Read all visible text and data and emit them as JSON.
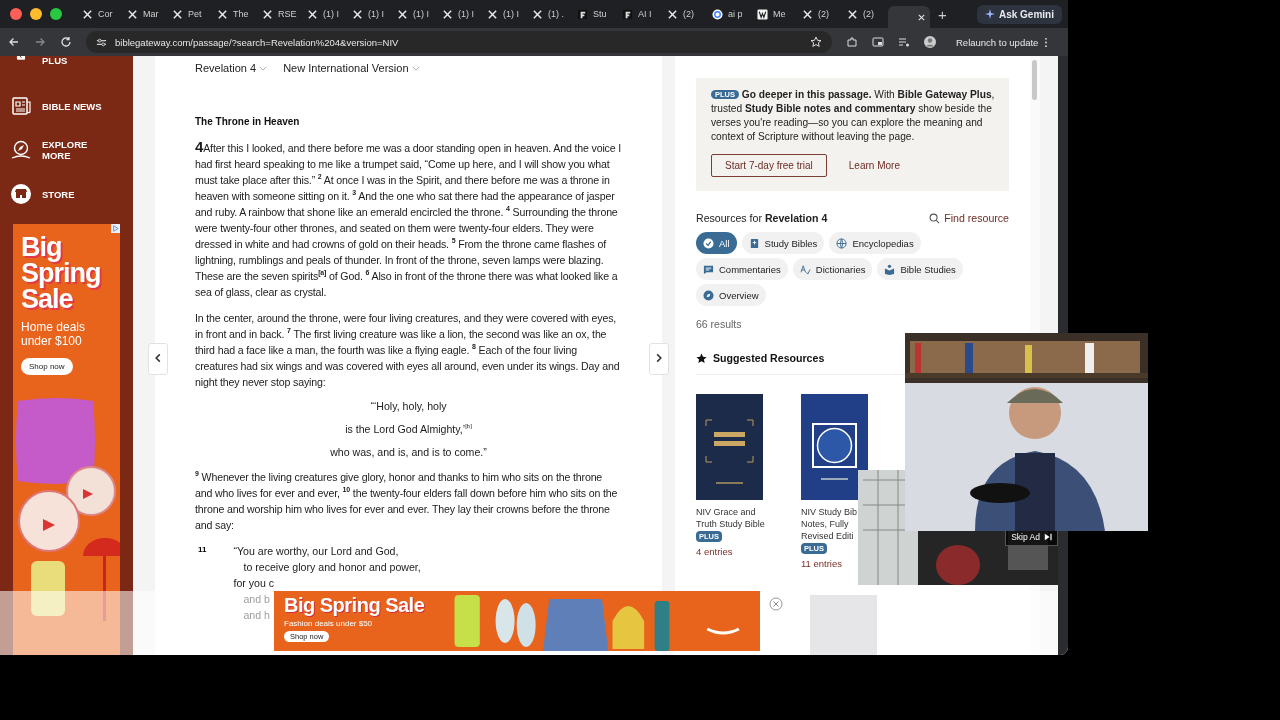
{
  "browser": {
    "tabs": [
      {
        "title": "Cor",
        "kind": "x",
        "selected": false
      },
      {
        "title": "Mar",
        "kind": "x",
        "selected": false
      },
      {
        "title": "Pet",
        "kind": "x",
        "selected": false
      },
      {
        "title": "The",
        "kind": "x",
        "selected": false
      },
      {
        "title": "RSE",
        "kind": "x",
        "selected": false
      },
      {
        "title": "(1) I",
        "kind": "x",
        "selected": false
      },
      {
        "title": "(1) I",
        "kind": "x",
        "selected": false
      },
      {
        "title": "(1) I",
        "kind": "x",
        "selected": false
      },
      {
        "title": "(1) I",
        "kind": "x",
        "selected": false
      },
      {
        "title": "(1) I",
        "kind": "x",
        "selected": false
      },
      {
        "title": "(1) .",
        "kind": "x",
        "selected": false
      },
      {
        "title": "Stu",
        "kind": "dark",
        "selected": false
      },
      {
        "title": "AI I",
        "kind": "dark",
        "selected": false
      },
      {
        "title": "(2)",
        "kind": "x",
        "selected": false
      },
      {
        "title": "ai p",
        "kind": "google",
        "selected": false
      },
      {
        "title": "Me",
        "kind": "light",
        "selected": false
      },
      {
        "title": "(2)",
        "kind": "x",
        "selected": false
      },
      {
        "title": "(2)",
        "kind": "x",
        "selected": false
      },
      {
        "kind": "blank",
        "selected": true
      }
    ],
    "new_tab": "+",
    "ask_button": "Ask Gemini",
    "url": "biblegateway.com/passage/?search=Revelation%204&version=NIV",
    "relaunch_button": "Relaunch to update"
  },
  "sidebar": {
    "items": [
      {
        "label": "PLUS",
        "kind": "plus"
      },
      {
        "label": "BIBLE NEWS",
        "kind": "news"
      },
      {
        "label": "EXPLORE MORE",
        "kind": "compass"
      },
      {
        "label": "STORE",
        "kind": "store"
      }
    ]
  },
  "side_ad": {
    "headline": "Big Spring Sale",
    "subline": "Home deals under $100",
    "button": "Shop now"
  },
  "passage": {
    "reference": "Revelation 4",
    "version": "New International Version",
    "heading": "The Throne in Heaven",
    "blocks": [
      {
        "kind": "prose",
        "chapter": "4",
        "text": "After this I looked, and there before me was a door standing open in heaven. And the voice I had first heard speaking to me like a trumpet said, “Come up here, and I will show you what must take place after this.” $^{2}$ At once I was in the Spirit, and there before me was a throne in heaven with someone sitting on it. $^{3}$ And the one who sat there had the appearance of jasper and ruby. A rainbow that shone like an emerald encircled the throne. $^{4}$ Surrounding the throne were twenty-four other thrones, and seated on them were twenty-four elders. They were dressed in white and had crowns of gold on their heads. $^{5}$ From the throne came flashes of lightning, rumblings and peals of thunder. In front of the throne, seven lamps were blazing. These are the seven spirits$^{[a]}$ of God. $^{6}$ Also in front of the throne there was what looked like a sea of glass, clear as crystal."
      },
      {
        "kind": "prose",
        "text": "In the center, around the throne, were four living creatures, and they were covered with eyes, in front and in back. $^{7}$ The first living creature was like a lion, the second was like an ox, the third had a face like a man, the fourth was like a flying eagle. $^{8}$ Each of the four living creatures had six wings and was covered with eyes all around, even under its wings. Day and night they never stop saying:"
      },
      {
        "kind": "centered",
        "lines": [
          {
            "text": "“‘Holy, holy, holy"
          },
          {
            "text": "is the Lord God Almighty,’$^{[b]}$"
          },
          {
            "text": "who was, and is, and is to come.”"
          }
        ]
      },
      {
        "kind": "prose",
        "text": "$^{9}$ Whenever the living creatures give glory, honor and thanks to him who sits on the throne and who lives for ever and ever, $^{10}$ the twenty-four elders fall down before him who sits on the throne and worship him who lives for ever and ever. They lay their crowns before the throne and say:"
      },
      {
        "kind": "poem",
        "verse": "11",
        "lines": [
          {
            "text": "“You are worthy, our Lord and God,",
            "indented": false
          },
          {
            "text": "to receive glory and honor and power,",
            "indented": true
          },
          {
            "text": "for you c",
            "indented": false
          },
          {
            "text": "and b",
            "indented": true
          },
          {
            "text": "and h",
            "indented": true
          }
        ]
      }
    ]
  },
  "promo": {
    "badge": "PLUS",
    "text": "**Go deeper in this passage.** With **Bible Gateway Plus**, trusted **Study Bible notes and commentary** show beside the verses you're reading—so you can explore the meaning and context of Scripture without leaving the page.",
    "trial_button": "Start 7-day free trial",
    "learn_link": "Learn More"
  },
  "resources": {
    "title": "Resources for **Revelation 4**",
    "find": "Find resource",
    "filters": [
      {
        "label": "All",
        "kind": "check",
        "selected": true
      },
      {
        "label": "Study Bibles",
        "kind": "book",
        "selected": false
      },
      {
        "label": "Encyclopedias",
        "kind": "globe",
        "selected": false
      },
      {
        "label": "Commentaries",
        "kind": "comment",
        "selected": false
      },
      {
        "label": "Dictionaries",
        "kind": "spell",
        "selected": false
      },
      {
        "label": "Bible Studies",
        "kind": "reader",
        "selected": false
      },
      {
        "label": "Overview",
        "kind": "compass",
        "selected": false
      }
    ],
    "count": "66 results",
    "suggested_title": "Suggested Resources",
    "books": [
      {
        "title_lines": [
          "NIV Grace and",
          "Truth Study Bible"
        ],
        "badge": "PLUS",
        "entries": "4 entries",
        "color": "#1d2b4a"
      },
      {
        "title_lines": [
          "NIV Study Bib",
          "Notes, Fully",
          "Revised Editi"
        ],
        "badge": "PLUS",
        "entries": "11 entries",
        "color": "#203f86"
      }
    ]
  },
  "video_ad": {
    "skip": "Skip Ad"
  },
  "bottom_ad": {
    "headline": "Big Spring Sale",
    "subline": "Fashion deals under $50",
    "button": "Shop now"
  }
}
